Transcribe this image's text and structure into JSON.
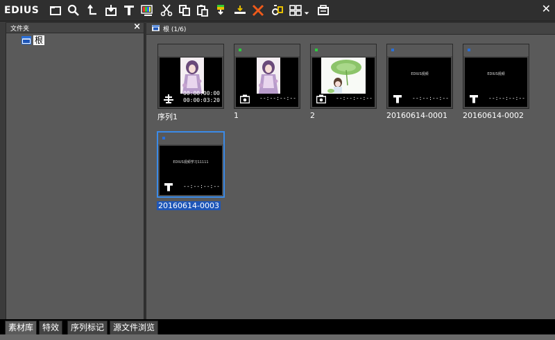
{
  "app": {
    "title": "EDIUS"
  },
  "toolbar": {
    "icons": [
      "new-folder-icon",
      "search-icon",
      "up-folder-icon",
      "import-icon",
      "title-icon",
      "color-bars-icon",
      "cut-icon",
      "copy-icon",
      "paste-icon",
      "add-to-player-icon",
      "add-to-timeline-icon",
      "delete-icon",
      "properties-icon",
      "view-mode-icon",
      "dropdown-icon",
      "export-icon"
    ]
  },
  "folder_panel": {
    "header": "文件夹",
    "root_label": "根"
  },
  "bin": {
    "path": "根 (1/6)",
    "clips": [
      {
        "label": "序列1",
        "tc_in": "00:00:00:00",
        "tc_out": "00:00:03:20",
        "type": "sequence",
        "dot_color": "",
        "thumb": "girl"
      },
      {
        "label": "1",
        "tc": "--:--:--:--",
        "type": "still",
        "dot_color": "#2ecc40",
        "thumb": "girl"
      },
      {
        "label": "2",
        "tc": "--:--:--:--",
        "type": "still",
        "dot_color": "#2ecc40",
        "thumb": "leaf"
      },
      {
        "label": "20160614-0001",
        "tc": "--:--:--:--",
        "type": "title",
        "dot_color": "#2a6fd8",
        "thumb_text": "EDIUS视频"
      },
      {
        "label": "20160614-0002",
        "tc": "--:--:--:--",
        "type": "title",
        "dot_color": "#2a6fd8",
        "thumb_text": "EDIUS视频"
      },
      {
        "label": "20160614-0003",
        "tc": "--:--:--:--",
        "type": "title",
        "dot_color": "#2a6fd8",
        "thumb_text": "EDIUS视频学习11111",
        "selected": true
      }
    ]
  },
  "tabs": [
    "素材库",
    "特效",
    "序列标记",
    "源文件浏览"
  ]
}
